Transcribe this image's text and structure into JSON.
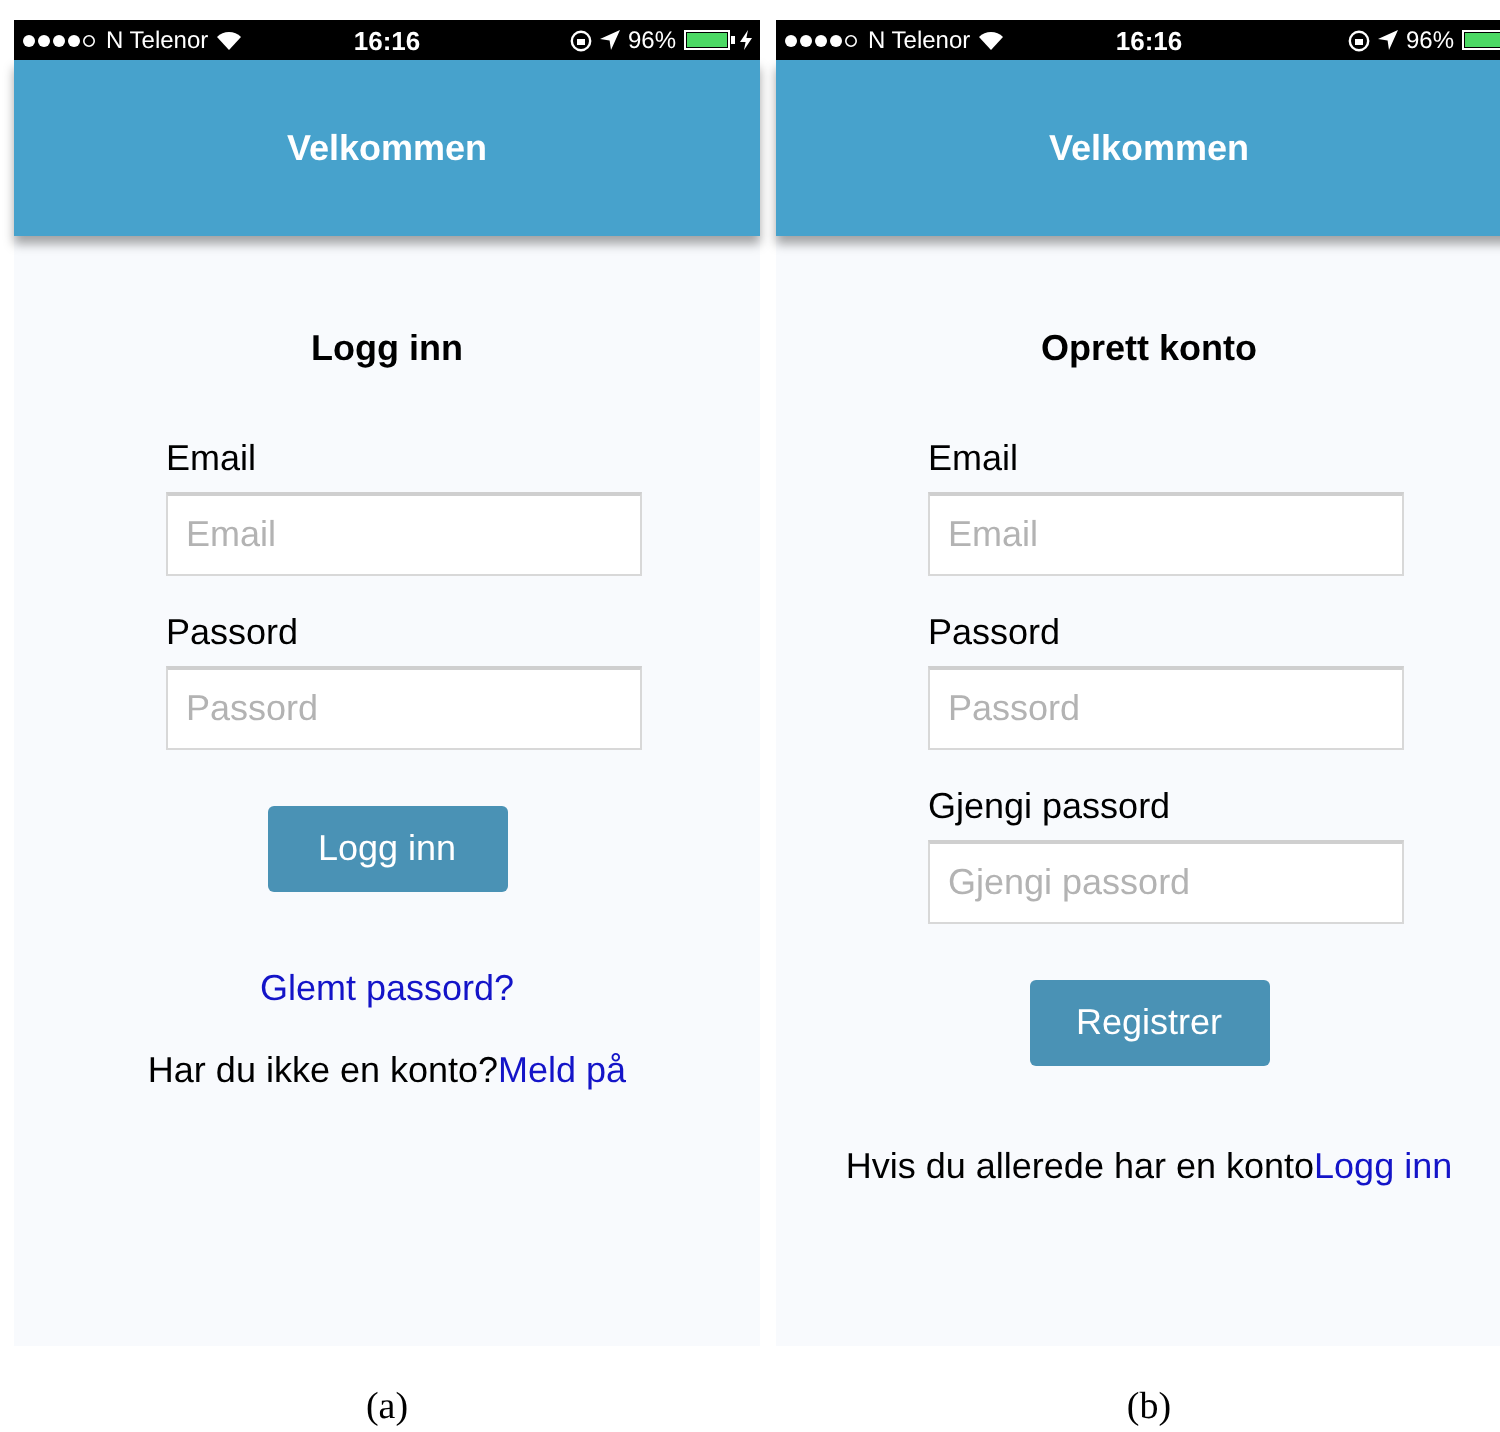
{
  "panels": [
    {
      "status_bar": {
        "carrier": "N Telenor",
        "time": "16:16",
        "battery": "96%",
        "charging": true
      },
      "header": {
        "title": "Velkommen"
      },
      "heading": "Logg inn",
      "fields": [
        {
          "label": "Email",
          "placeholder": "Email"
        },
        {
          "label": "Passord",
          "placeholder": "Passord"
        }
      ],
      "button": "Logg inn",
      "footer_lines": [
        {
          "parts": [
            {
              "kind": "link",
              "text": "Glemt passord?"
            }
          ]
        },
        {
          "parts": [
            {
              "kind": "text",
              "text": "Har du ikke en konto?"
            },
            {
              "kind": "link",
              "text": "Meld på"
            }
          ]
        }
      ],
      "caption": "(a)"
    },
    {
      "status_bar": {
        "carrier": "N Telenor",
        "time": "16:16",
        "battery": "96%",
        "charging": false
      },
      "header": {
        "title": "Velkommen"
      },
      "heading": "Oprett konto",
      "fields": [
        {
          "label": "Email",
          "placeholder": "Email"
        },
        {
          "label": "Passord",
          "placeholder": "Passord"
        },
        {
          "label": "Gjengi passord",
          "placeholder": "Gjengi passord"
        }
      ],
      "button": "Registrer",
      "footer_lines": [
        {
          "parts": [
            {
              "kind": "text",
              "text": "Hvis du allerede har en konto"
            },
            {
              "kind": "link",
              "text": "Logg inn"
            }
          ]
        }
      ],
      "caption": "(b)"
    }
  ]
}
